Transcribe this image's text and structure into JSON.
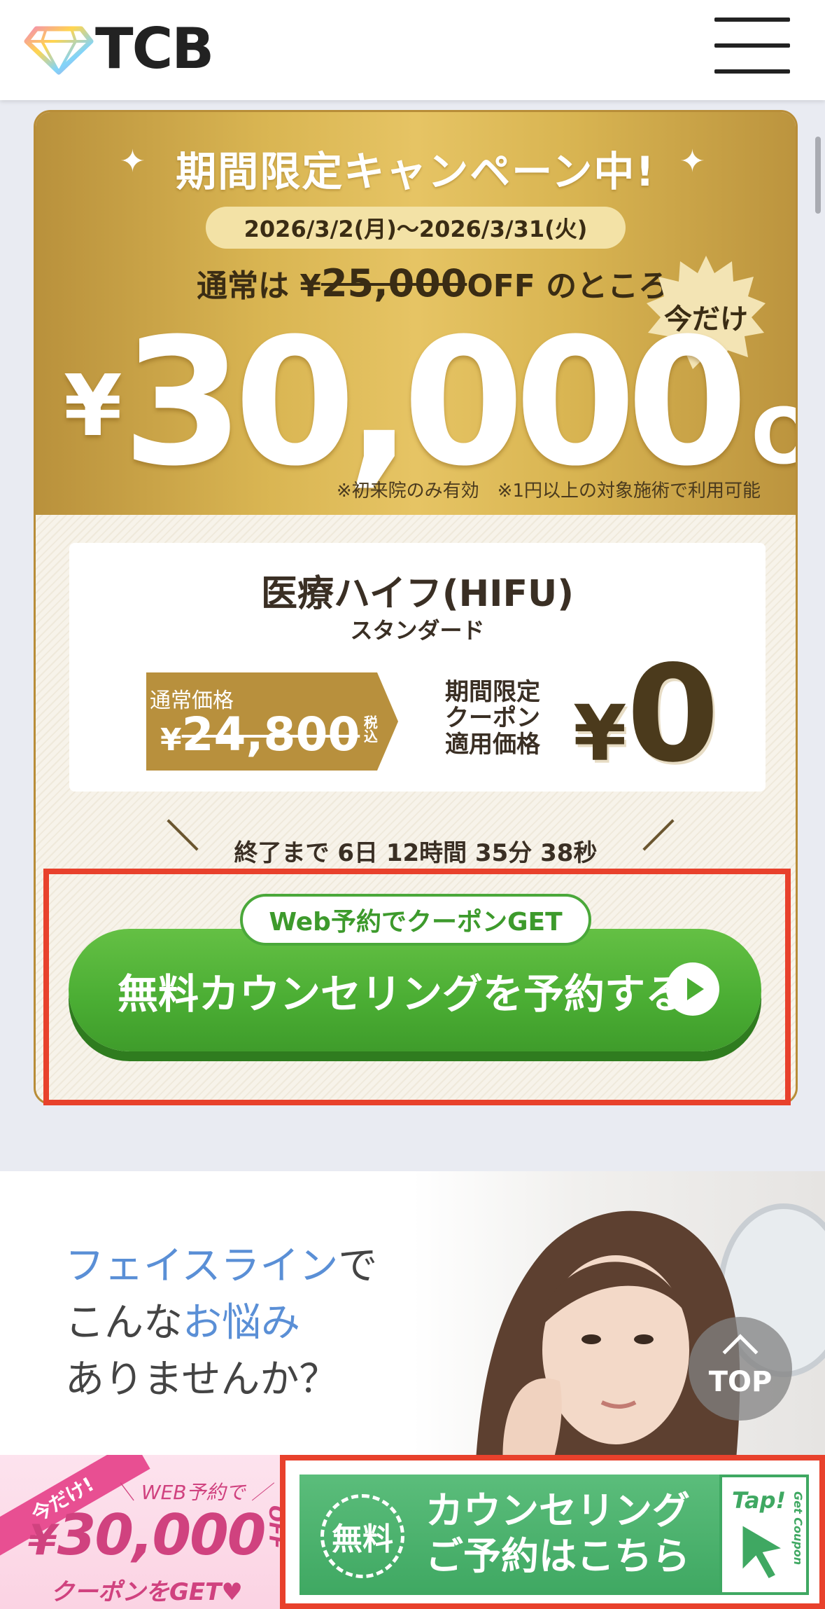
{
  "header": {
    "logo_text": "TCB"
  },
  "campaign": {
    "title": "期間限定キャンペーン中!",
    "date_range": "2026/3/2(月)〜2026/3/31(火)",
    "normally_prefix": "通常は ¥",
    "normally_strike": "25,000",
    "normally_suffix": "OFF のところ",
    "badge": "今だけ",
    "big_yen": "¥",
    "big_amount": "30,000",
    "big_off": "OFF",
    "note": "※初来院のみ有効　※1円以上の対象施術で利用可能"
  },
  "product": {
    "name": "医療ハイフ(HIFU)",
    "plan": "スタンダード",
    "regular_label": "通常価格",
    "regular_yen": "¥",
    "regular_price": "24,800",
    "tax_label": "税込",
    "coupon_label_1": "期間限定",
    "coupon_label_2": "クーポン",
    "coupon_label_3": "適用価格",
    "coupon_yen": "¥",
    "coupon_price": "0"
  },
  "countdown": {
    "text": "終了まで 6日 12時間 35分 38秒"
  },
  "cta": {
    "tag": "Web予約でクーポンGET",
    "label": "無料カウンセリングを予約する"
  },
  "face_section": {
    "line1_blue": "フェイスライン",
    "line1_rest": "で",
    "line2_prefix": "こんな",
    "line2_blue": "お悩み",
    "line3": "ありませんか？"
  },
  "top_button": {
    "label": "TOP"
  },
  "bottom_bar": {
    "ribbon": "今だけ!",
    "web_text": "＼ WEB予約で ／",
    "price_yen": "¥",
    "price": "30,000",
    "price_off": "OFF",
    "coupon_text": "クーポンをGET♥",
    "free_label": "無料",
    "counsel_line1": "カウンセリング",
    "counsel_line2": "ご予約はこちら",
    "tap_label": "Tap!",
    "tap_side": "Get Coupon"
  },
  "colors": {
    "gold": "#d9b552",
    "green": "#4aad33",
    "highlight_red": "#e8412c",
    "blue_text": "#5a8fd6",
    "pink": "#d0427f"
  }
}
